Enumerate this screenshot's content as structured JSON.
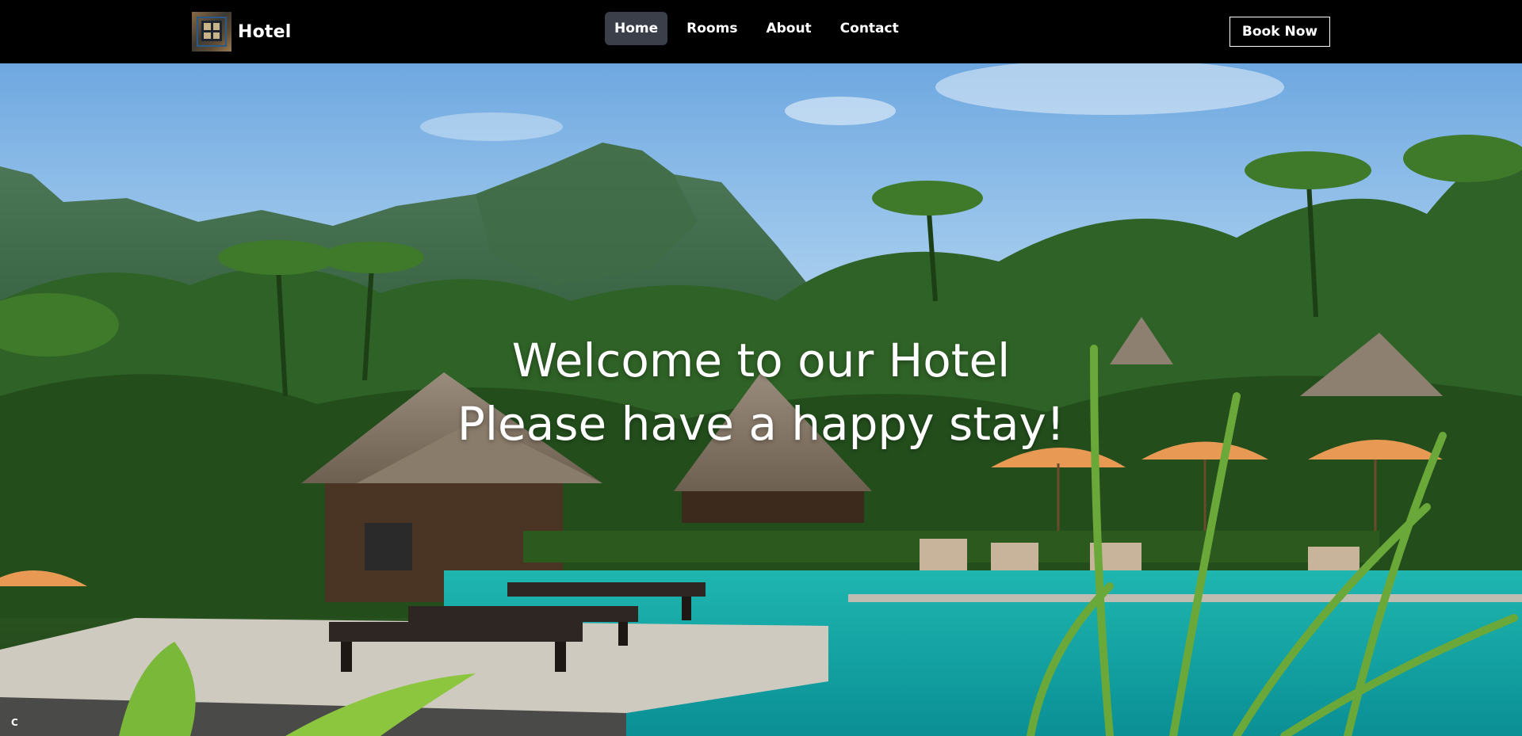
{
  "brand": {
    "name": "Hotel",
    "logo_icon": "hotel-window-logo"
  },
  "nav": {
    "items": [
      {
        "label": "Home",
        "active": true
      },
      {
        "label": "Rooms",
        "active": false
      },
      {
        "label": "About",
        "active": false
      },
      {
        "label": "Contact",
        "active": false
      }
    ],
    "cta_label": "Book Now"
  },
  "hero": {
    "title_line1": "Welcome to our Hotel",
    "title_line2": "Please have a happy stay!",
    "background": "tropical-resort-pool-photo"
  },
  "corner_badge": "C",
  "colors": {
    "navbar_bg": "#000000",
    "active_tab_bg": "#3a3f4a",
    "text": "#ffffff"
  }
}
